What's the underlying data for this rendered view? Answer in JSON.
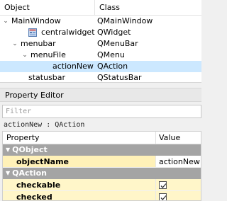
{
  "inspector": {
    "columns": {
      "object": "Object",
      "class": "Class"
    },
    "rows": [
      {
        "name": "MainWindow",
        "class": "QMainWindow"
      },
      {
        "name": "centralwidget",
        "class": "QWidget"
      },
      {
        "name": "menubar",
        "class": "QMenuBar"
      },
      {
        "name": "menuFile",
        "class": "QMenu"
      },
      {
        "name": "actionNew",
        "class": "QAction"
      },
      {
        "name": "statusbar",
        "class": "QStatusBar"
      }
    ],
    "selected": "actionNew"
  },
  "property_editor": {
    "title": "Property Editor",
    "filter_placeholder": "Filter",
    "object_line": "actionNew : QAction",
    "columns": {
      "property": "Property",
      "value": "Value"
    },
    "groups": [
      {
        "name": "QObject",
        "props": [
          {
            "name": "objectName",
            "value": "actionNew"
          }
        ]
      },
      {
        "name": "QAction",
        "props": [
          {
            "name": "checkable",
            "value": "checked"
          },
          {
            "name": "checked",
            "value": "checked"
          }
        ]
      }
    ]
  },
  "colors": {
    "selection": "#cce8ff",
    "group_header": "#a4a4a4",
    "property_highlight": "#fff6c9"
  }
}
